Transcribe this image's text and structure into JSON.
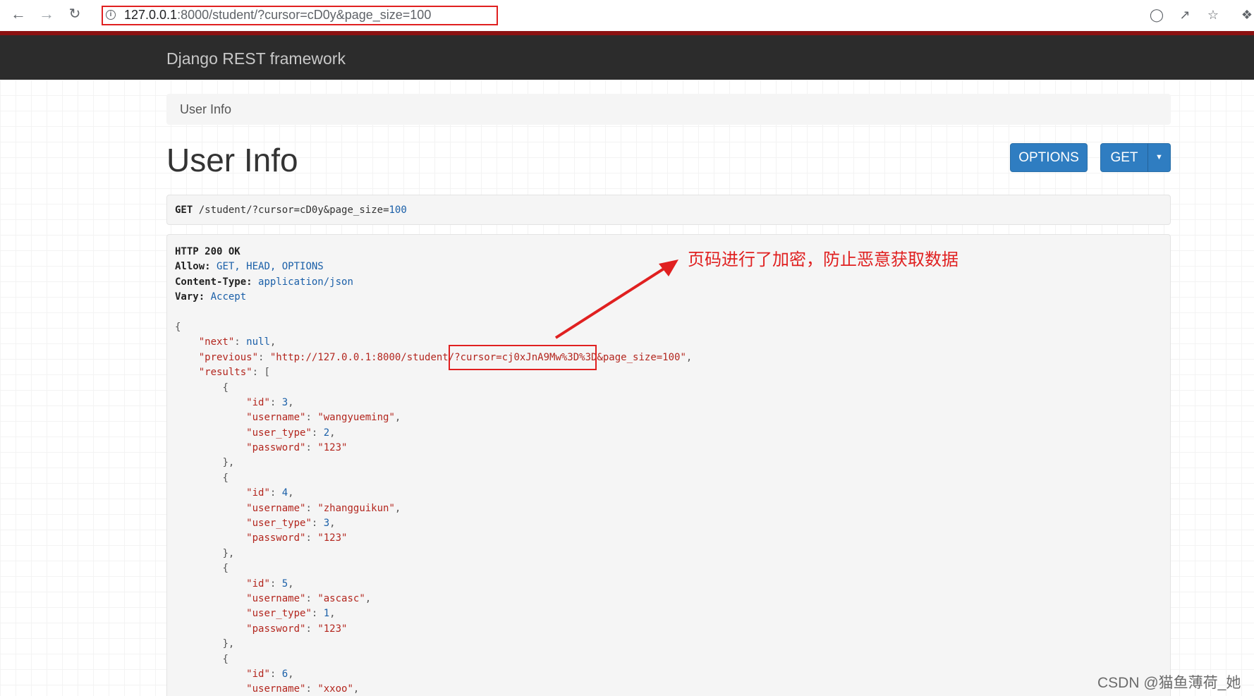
{
  "browser": {
    "url_host": "127.0.0.1",
    "url_rest": ":8000/student/?cursor=cD0y&page_size=100",
    "icons": [
      "back-arrow-icon",
      "forward-arrow-icon",
      "reload-icon",
      "info-icon",
      "translate-icon",
      "share-icon",
      "star-icon",
      "extensions-icon"
    ]
  },
  "navbar": {
    "brand": "Django REST framework"
  },
  "breadcrumb": {
    "label": "User Info"
  },
  "page": {
    "title": "User Info"
  },
  "buttons": {
    "options": "OPTIONS",
    "get": "GET",
    "caret": "▼"
  },
  "request": {
    "method": "GET",
    "path": "/student/?",
    "param1_key": "cursor",
    "eq1": "=",
    "param1_val": "cD0y",
    "amp": "&",
    "param2_key": "page_size",
    "eq2": "=",
    "param2_val": "100"
  },
  "response": {
    "status": "HTTP 200 OK",
    "allow_key": "Allow:",
    "allow_val": "GET, HEAD, OPTIONS",
    "content_type_key": "Content-Type:",
    "content_type_val": "application/json",
    "vary_key": "Vary:",
    "vary_val": "Accept",
    "open_brace": "{",
    "next_key": "\"next\"",
    "next_val": "null",
    "previous_key": "\"previous\"",
    "previous_val": "\"http://127.0.0.1:8000/student/?cursor=cj0xJnA9Mw%3D%3D&page_size=100\"",
    "results_key": "\"results\"",
    "results_open": "[",
    "results": [
      {
        "id": "3",
        "username": "\"wangyueming\"",
        "user_type": "2",
        "password": "\"123\""
      },
      {
        "id": "4",
        "username": "\"zhangguikun\"",
        "user_type": "3",
        "password": "\"123\""
      },
      {
        "id": "5",
        "username": "\"ascasc\"",
        "user_type": "1",
        "password": "\"123\""
      },
      {
        "id": "6",
        "username": "\"xxoo\""
      }
    ],
    "id_key": "\"id\"",
    "username_key": "\"username\"",
    "user_type_key": "\"user_type\"",
    "password_key": "\"password\""
  },
  "annotation": {
    "text": "页码进行了加密，防止恶意获取数据",
    "color": "#e02020"
  },
  "watermark": "CSDN @猫鱼薄荷_她",
  "colors": {
    "navbar": "#2c2c2c",
    "accent_strip": "#8b1111",
    "button": "#2f7dc1",
    "highlight": "#e02020"
  }
}
